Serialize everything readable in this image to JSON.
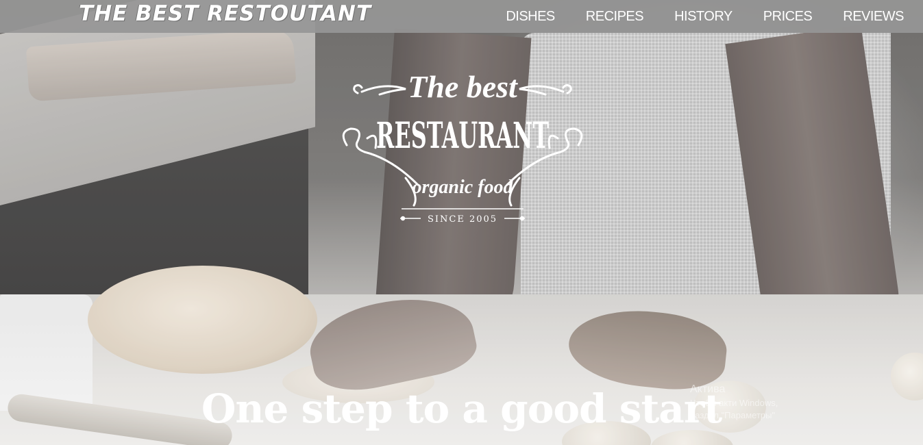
{
  "navbar": {
    "brand": "THE BEST RESTOUTANT",
    "links": [
      {
        "label": "DISHES"
      },
      {
        "label": "RECIPES"
      },
      {
        "label": "HISTORY"
      },
      {
        "label": "PRICES"
      },
      {
        "label": "REVIEWS"
      }
    ]
  },
  "logo": {
    "script_top": "The best",
    "main": "RESTAURANT",
    "script_bottom": "organic food",
    "since": "SINCE 2005"
  },
  "hero": {
    "headline": "One step to a good start"
  },
  "watermark": {
    "title": "Актива",
    "line1": "Чтобы  акти   Windows,",
    "line2": "раздел \"Параметры\""
  },
  "colors": {
    "nav_bg": "#969696",
    "text": "#ffffff"
  }
}
